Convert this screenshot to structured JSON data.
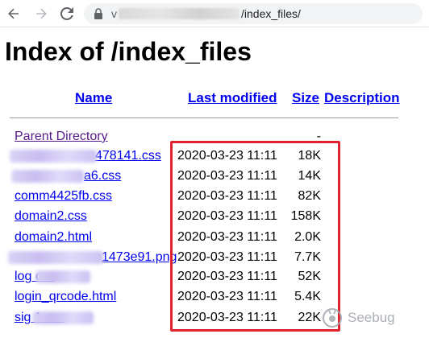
{
  "browser": {
    "url_host_prefix": "v",
    "url_path": "/index_files/"
  },
  "page": {
    "title": "Index of /index_files"
  },
  "table": {
    "headers": {
      "name": "Name",
      "last_modified": "Last modified",
      "size": "Size",
      "description": "Description"
    },
    "parent": {
      "name": "Parent Directory",
      "size": "-"
    },
    "rows": [
      {
        "name_visible": "478141.css",
        "date": "2020-03-23 11:11",
        "size": "18K"
      },
      {
        "name_visible": "a6.css",
        "date": "2020-03-23 11:11",
        "size": "14K"
      },
      {
        "name_visible": "comm4425fb.css",
        "date": "2020-03-23 11:11",
        "size": "82K"
      },
      {
        "name_visible": "domain2.css",
        "date": "2020-03-23 11:11",
        "size": "158K"
      },
      {
        "name_visible": "domain2.html",
        "date": "2020-03-23 11:11",
        "size": "2.0K"
      },
      {
        "name_visible": "1473e91.png",
        "date": "2020-03-23 11:11",
        "size": "7.7K"
      },
      {
        "name_visible": "log                css",
        "date": "2020-03-23 11:11",
        "size": "52K"
      },
      {
        "name_visible": "login_qrcode.html",
        "date": "2020-03-23 11:11",
        "size": "5.4K"
      },
      {
        "name_visible": "sig               1.css",
        "date": "2020-03-23 11:11",
        "size": "22K"
      }
    ]
  },
  "watermark": {
    "text": "Seebug"
  },
  "colors": {
    "link": "#0000ee",
    "visited_link": "#551a8b",
    "highlight": "#e0222f"
  }
}
